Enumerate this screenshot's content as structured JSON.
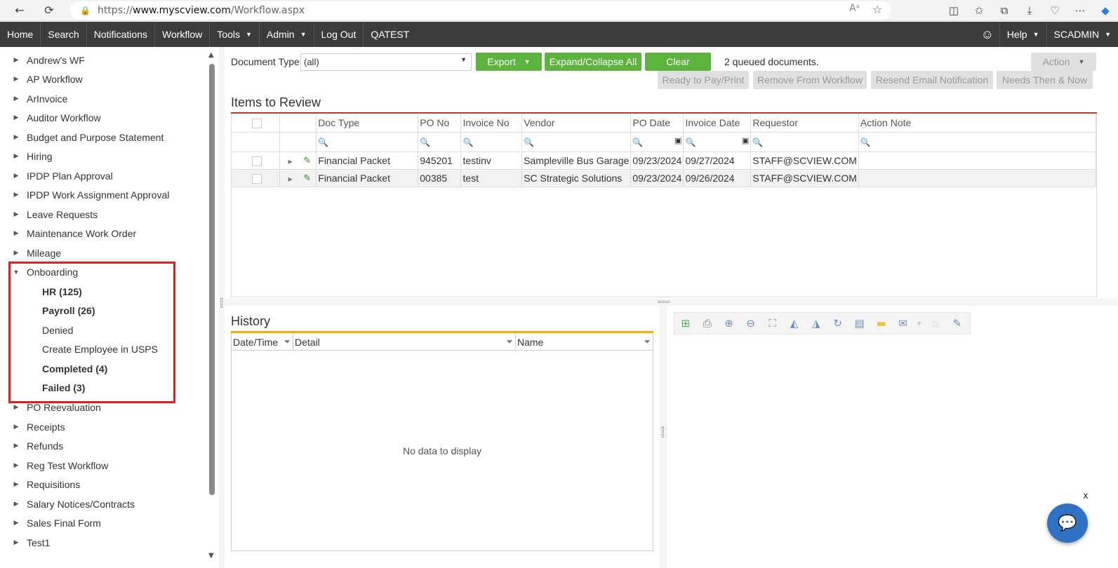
{
  "browser": {
    "url_prefix": "https://",
    "url_domain": "www.myscview.com",
    "url_path": "/Workflow.aspx",
    "read_aloud_label": "Aᵃ"
  },
  "nav": {
    "items": [
      "Home",
      "Search",
      "Notifications",
      "Workflow",
      "Tools",
      "Admin",
      "Log Out",
      "QATEST"
    ],
    "help": "Help",
    "user": "SCADMIN"
  },
  "tree": {
    "items": [
      "Andrew's WF",
      "AP Workflow",
      "ArInvoice",
      "Auditor Workflow",
      "Budget and Purpose Statement",
      "Hiring",
      "IPDP Plan Approval",
      "IPDP Work Assignment Approval",
      "Leave Requests",
      "Maintenance Work Order",
      "Mileage",
      "Onboarding",
      "PO Reevaluation",
      "Receipts",
      "Refunds",
      "Reg Test Workflow",
      "Requisitions",
      "Salary Notices/Contracts",
      "Sales Final Form",
      "Test1"
    ],
    "onboarding_children": [
      {
        "label": "HR (125)",
        "bold": true
      },
      {
        "label": "Payroll (26)",
        "bold": true
      },
      {
        "label": "Denied",
        "bold": false
      },
      {
        "label": "Create Employee in USPS",
        "bold": false
      },
      {
        "label": "Completed (4)",
        "bold": true
      },
      {
        "label": "Failed (3)",
        "bold": true
      }
    ]
  },
  "toolbar": {
    "doc_type_label": "Document Type",
    "doc_type_value": "(all)",
    "export": "Export",
    "expand_collapse": "Expand/Collapse All",
    "clear": "Clear",
    "queued": "2 queued documents.",
    "action": "Action",
    "ready_to_pay": "Ready to Pay/Print",
    "remove_from_workflow": "Remove From Workflow",
    "resend_email": "Resend Email Notification",
    "needs_then_now": "Needs Then & Now"
  },
  "items": {
    "title": "Items to Review",
    "columns": [
      "Doc Type",
      "PO No",
      "Invoice No",
      "Vendor",
      "PO Date",
      "Invoice Date",
      "Requestor",
      "Action Note"
    ],
    "rows": [
      {
        "doc_type": "Financial Packet",
        "po_no": "945201",
        "invoice_no": "testinv",
        "vendor": "Sampleville Bus Garage",
        "po_date": "09/23/2024",
        "invoice_date": "09/27/2024",
        "requestor": "STAFF@SCVIEW.COM",
        "action_note": ""
      },
      {
        "doc_type": "Financial Packet",
        "po_no": "00385",
        "invoice_no": "test",
        "vendor": "SC Strategic Solutions",
        "po_date": "09/23/2024",
        "invoice_date": "09/26/2024",
        "requestor": "STAFF@SCVIEW.COM",
        "action_note": ""
      }
    ]
  },
  "history": {
    "title": "History",
    "columns": [
      "Date/Time",
      "Detail",
      "Name"
    ],
    "empty": "No data to display"
  },
  "chat": {
    "close": "x"
  },
  "colors": {
    "accent_green": "#5cb33e",
    "items_rule": "#c0392b",
    "history_rule": "#f0b000",
    "highlight": "#e0201f",
    "nav_bg": "#3c3c3c"
  }
}
